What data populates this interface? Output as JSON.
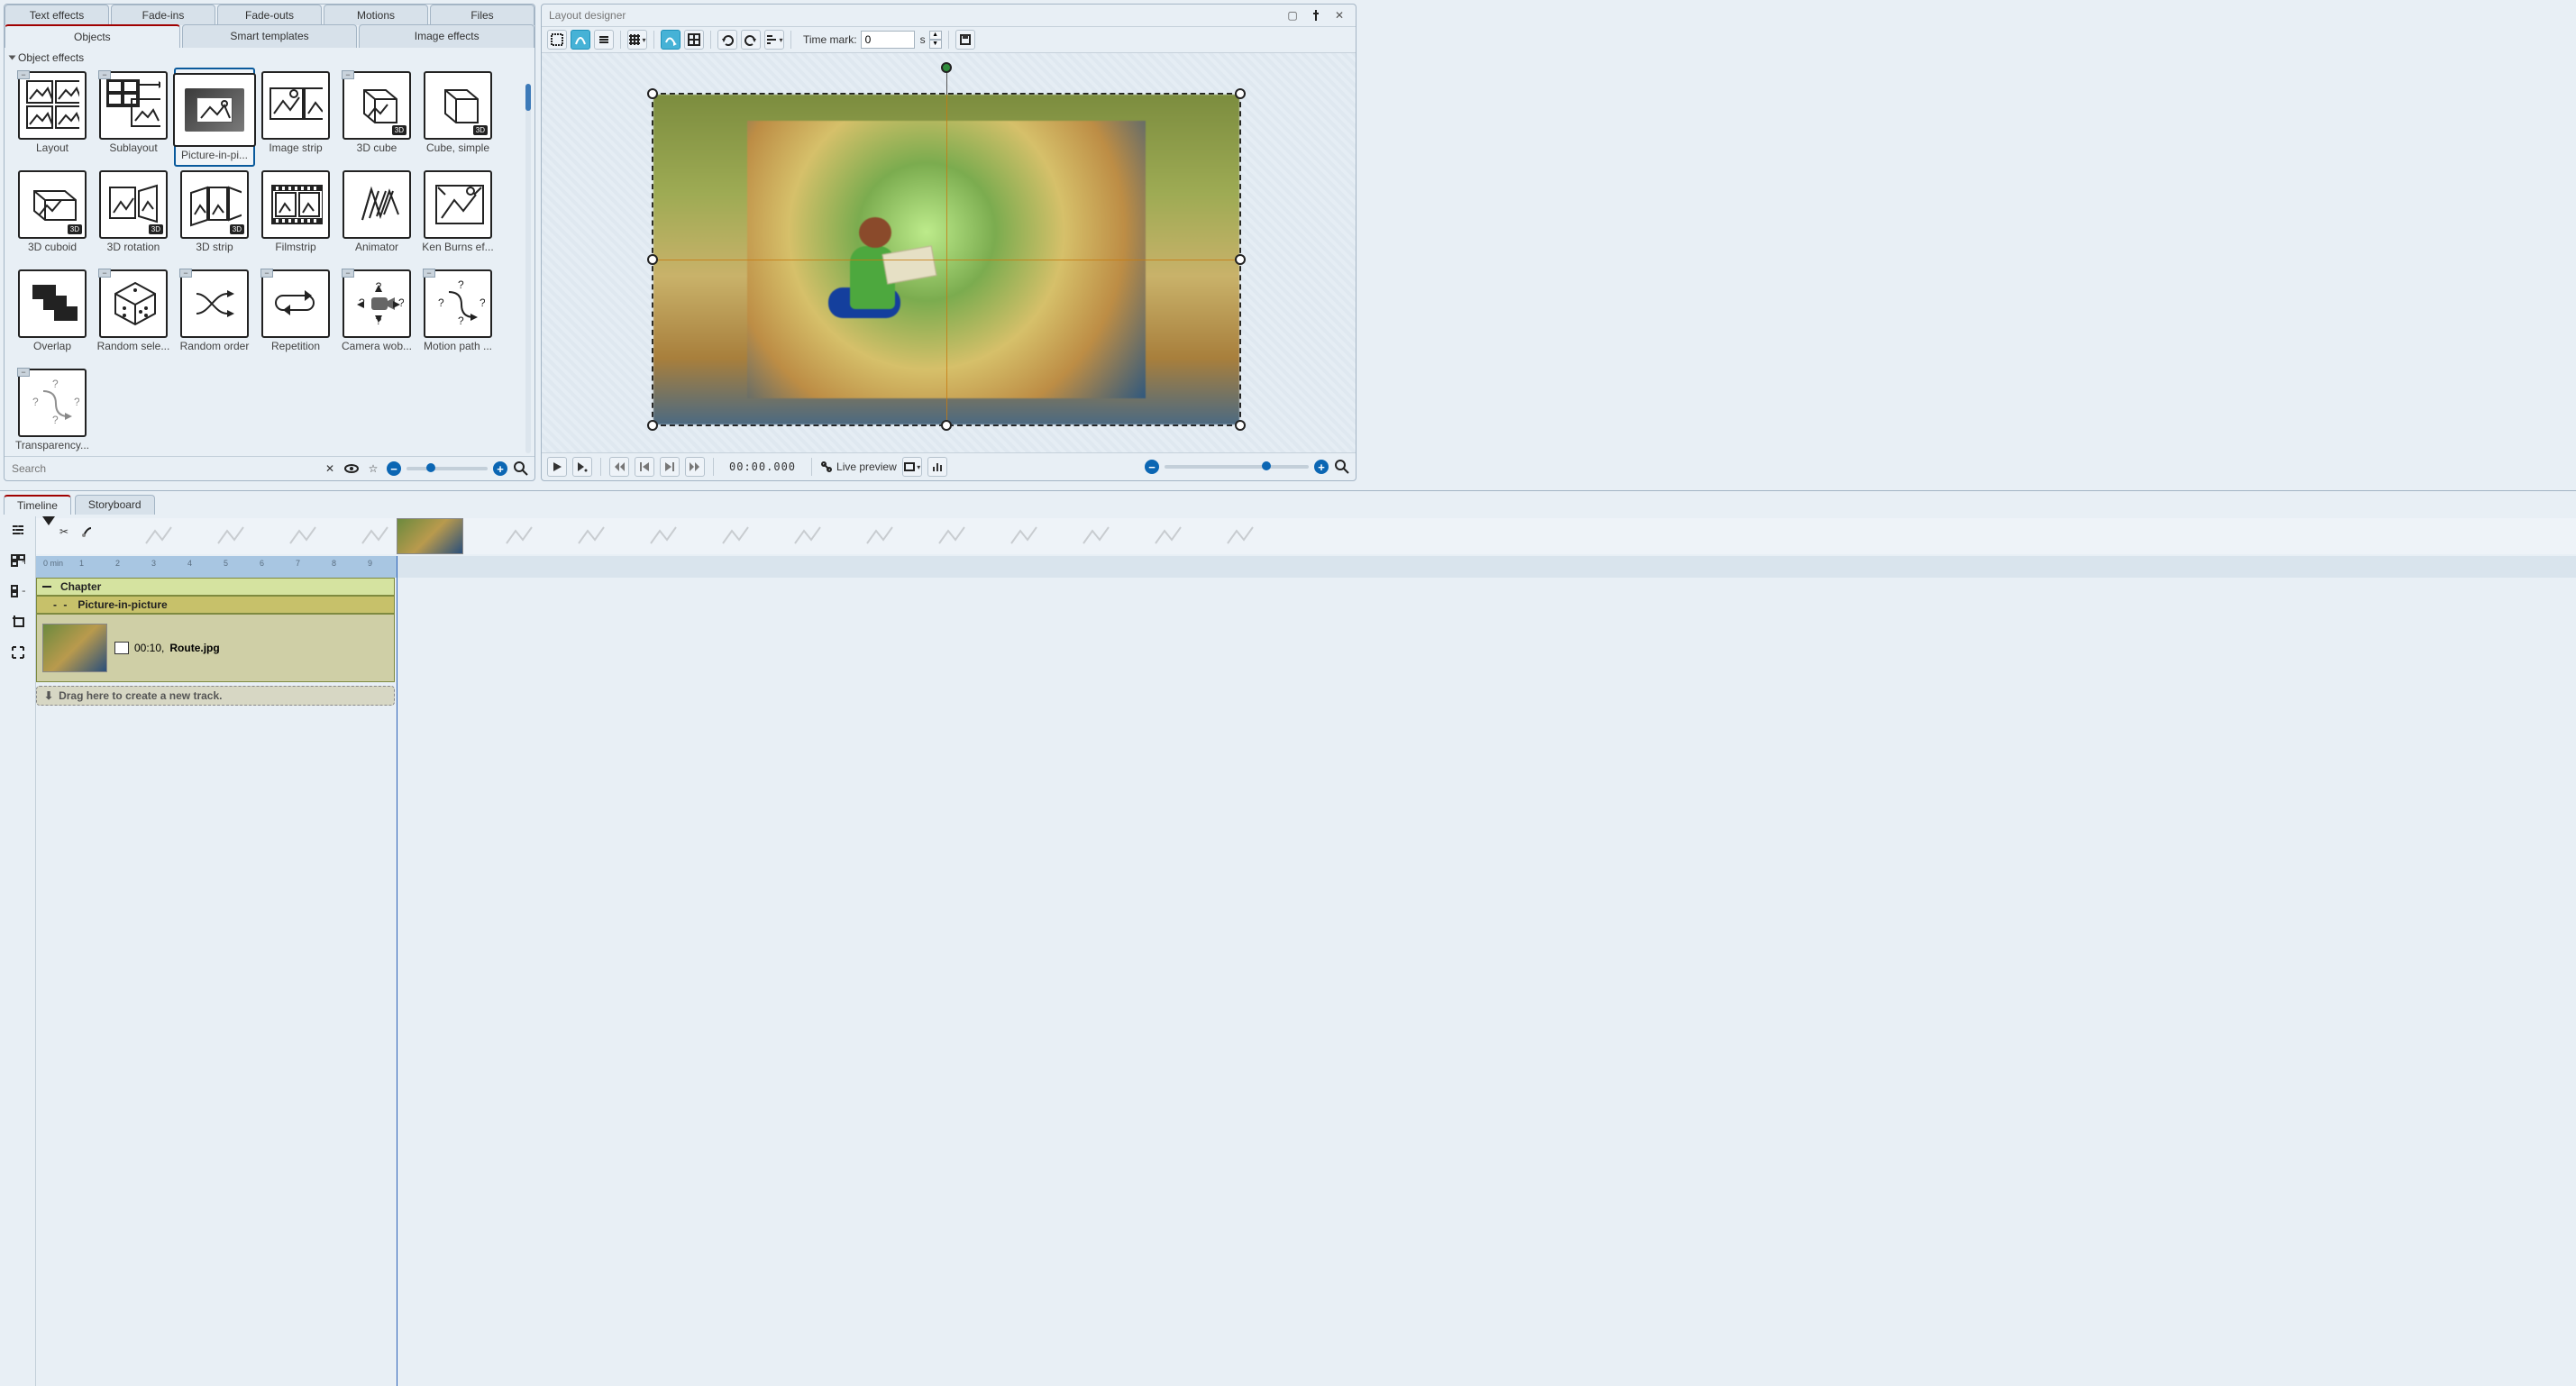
{
  "leftPanel": {
    "topTabs": [
      "Text effects",
      "Fade-ins",
      "Fade-outs",
      "Motions",
      "Files"
    ],
    "subTabs": [
      "Objects",
      "Smart templates",
      "Image effects"
    ],
    "activeTop": 0,
    "activeSub": 0,
    "section": "Object effects",
    "items": [
      {
        "label": "Layout",
        "badge": null,
        "toggle": true
      },
      {
        "label": "Sublayout",
        "badge": null,
        "toggle": true
      },
      {
        "label": "Picture-in-pi...",
        "badge": null,
        "selected": true
      },
      {
        "label": "Image strip",
        "badge": null
      },
      {
        "label": "3D cube",
        "badge": "3D",
        "toggle": true
      },
      {
        "label": "Cube, simple",
        "badge": "3D"
      },
      {
        "label": "3D cuboid",
        "badge": "3D"
      },
      {
        "label": "3D rotation",
        "badge": "3D"
      },
      {
        "label": "3D strip",
        "badge": "3D"
      },
      {
        "label": "Filmstrip",
        "badge": null
      },
      {
        "label": "Animator",
        "badge": null
      },
      {
        "label": "Ken Burns ef...",
        "badge": null
      },
      {
        "label": "Overlap",
        "badge": null
      },
      {
        "label": "Random sele...",
        "badge": null,
        "toggle": true
      },
      {
        "label": "Random order",
        "badge": null,
        "toggle": true
      },
      {
        "label": "Repetition",
        "badge": null,
        "toggle": true
      },
      {
        "label": "Camera wob...",
        "badge": null,
        "toggle": true
      },
      {
        "label": "Motion path ...",
        "badge": null,
        "toggle": true
      },
      {
        "label": "Transparency...",
        "badge": null,
        "toggle": true
      }
    ],
    "searchPlaceholder": "Search"
  },
  "layoutDesigner": {
    "title": "Layout designer",
    "timeLabel": "Time mark:",
    "timeValue": "0",
    "timeUnit": "s",
    "timecode": "00:00.000",
    "livePreview": "Live preview"
  },
  "timeline": {
    "tabs": [
      "Timeline",
      "Storyboard"
    ],
    "active": 0,
    "rulerStart": "0 min",
    "ticks": [
      "1",
      "2",
      "3",
      "4",
      "5",
      "6",
      "7",
      "8",
      "9"
    ],
    "chapter": "Chapter",
    "pip": "Picture-in-picture",
    "clipDur": "00:10,",
    "clipName": "Route.jpg",
    "dropHint": "Drag here to create a new track."
  }
}
